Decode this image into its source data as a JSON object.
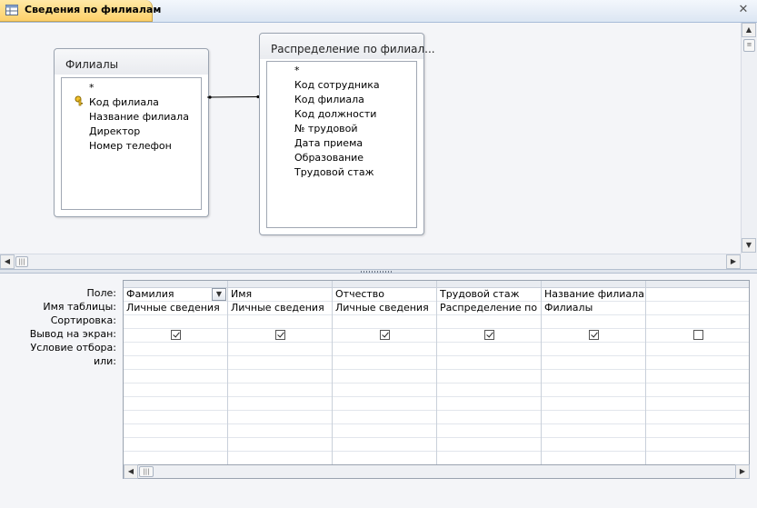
{
  "window": {
    "tab_title": "Сведения по филиалам",
    "close_glyph": "✕"
  },
  "tables": [
    {
      "title": "Филиалы",
      "fields": [
        "*",
        "Код филиала",
        "Название филиала",
        "Директор",
        "Номер телефон"
      ],
      "primary_key_field": "Код филиала"
    },
    {
      "title": "Распределение по филиал...",
      "fields": [
        "*",
        "Код сотрудника",
        "Код филиала",
        "Код должности",
        "№ трудовой",
        "Дата приема",
        "Образование",
        "Трудовой стаж"
      ]
    }
  ],
  "grid": {
    "row_labels": {
      "field": "Поле:",
      "table": "Имя таблицы:",
      "sort": "Сортировка:",
      "show": "Вывод на экран:",
      "criteria": "Условие отбора:",
      "or": "или:"
    },
    "columns": [
      {
        "field": "Фамилия",
        "table": "Личные сведения",
        "show": true
      },
      {
        "field": "Имя",
        "table": "Личные сведения",
        "show": true
      },
      {
        "field": "Отчество",
        "table": "Личные сведения",
        "show": true
      },
      {
        "field": "Трудовой стаж",
        "table": "Распределение по ф",
        "show": true
      },
      {
        "field": "Название филиала",
        "table": "Филиалы",
        "show": true
      },
      {
        "field": "",
        "table": "",
        "show": false
      }
    ]
  },
  "icons": {
    "tab": "query-icon",
    "key": "primary-key-icon",
    "scroll_up": "▲",
    "scroll_down": "▼",
    "scroll_left": "◀",
    "scroll_right": "▶",
    "dropdown": "▼"
  },
  "colors": {
    "tab_bg": "#fdd06a",
    "pane_bg": "#f4f5f8",
    "border": "#9aa3b0"
  }
}
